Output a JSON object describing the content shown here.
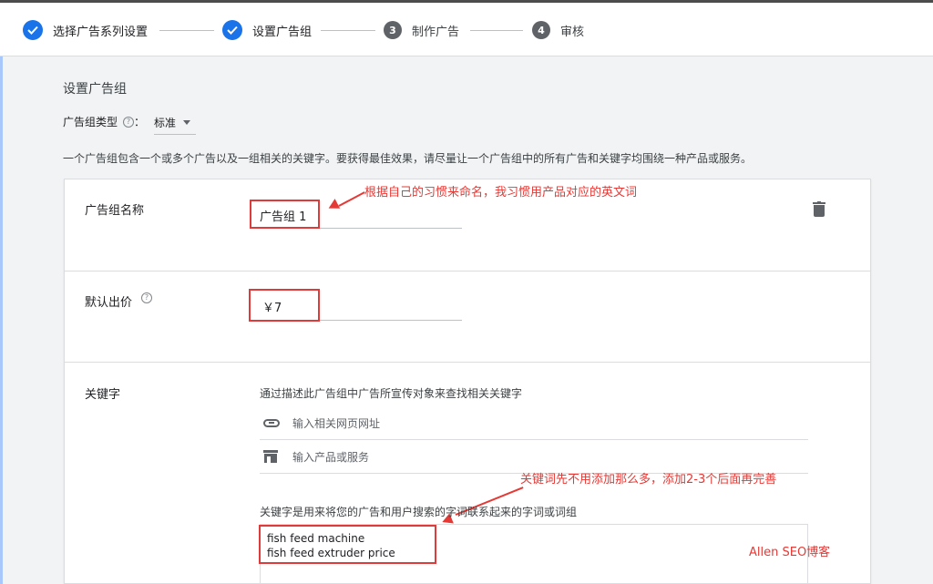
{
  "stepper": {
    "steps": [
      {
        "label": "选择广告系列设置",
        "state": "done"
      },
      {
        "label": "设置广告组",
        "state": "done"
      },
      {
        "label": "制作广告",
        "state": "pending",
        "number": "3"
      },
      {
        "label": "审核",
        "state": "pending",
        "number": "4"
      }
    ]
  },
  "page": {
    "section_title": "设置广告组",
    "ad_group_type_label": "广告组类型",
    "help_symbol": "?",
    "ad_group_type_colon": "：",
    "ad_group_type_value": "标准",
    "description": "一个广告组包含一个或多个广告以及一组相关的关键字。要获得最佳效果，请尽量让一个广告组中的所有广告和关键字均围绕一种产品或服务。"
  },
  "form": {
    "name_label": "广告组名称",
    "name_value": "广告组 1",
    "bid_label": "默认出价",
    "bid_value": "￥7",
    "keywords_label": "关键字",
    "keywords_hint": "通过描述此广告组中广告所宣传对象来查找相关关键字",
    "url_placeholder": "输入相关网页网址",
    "product_placeholder": "输入产品或服务",
    "keywords_desc": "关键字是用来将您的广告和用户搜索的字词联系起来的字词或词组",
    "keywords": [
      "fish feed machine",
      "fish feed extruder price"
    ]
  },
  "annotations": {
    "name_note": "根据自己的习惯来命名，我习惯用产品对应的英文词",
    "keywords_note": "关键词先不用添加那么多，添加2-3个后面再完善",
    "watermark": "Allen SEO博客"
  },
  "colors": {
    "accent": "#1a73e8",
    "annotation_red": "#e53935"
  }
}
